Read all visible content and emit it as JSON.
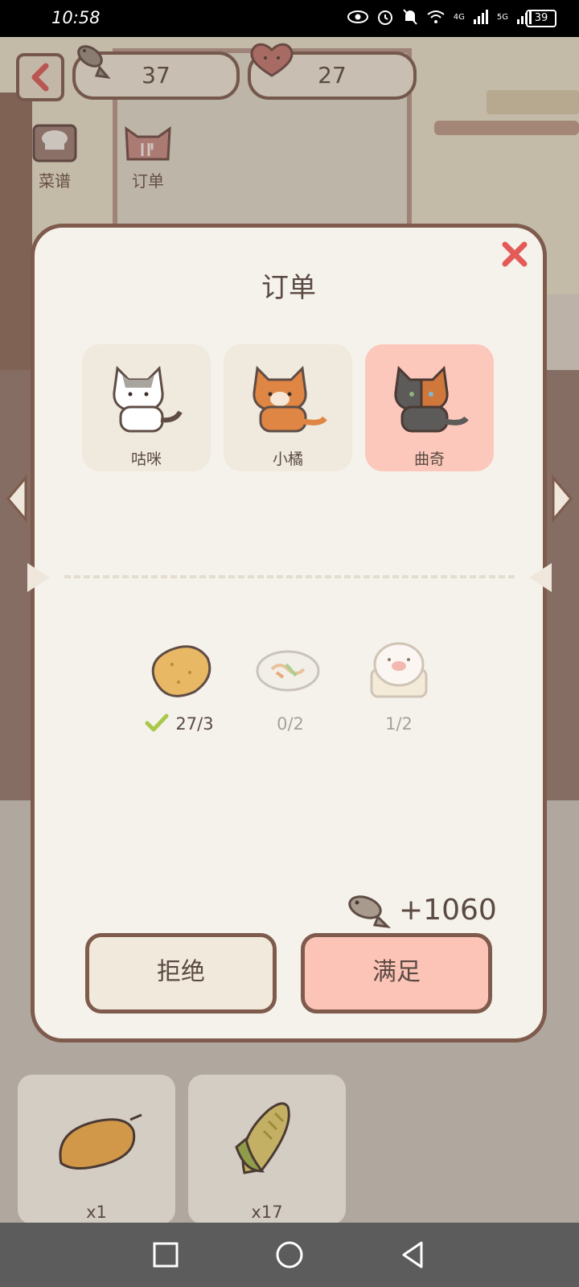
{
  "status_bar": {
    "time": "10:58",
    "net1": "4G",
    "net2": "5G",
    "battery": "39"
  },
  "hud": {
    "fish_count": "37",
    "heart_count": "27",
    "recipe_label": "菜谱",
    "order_label": "订单"
  },
  "modal": {
    "title": "订单",
    "cats": [
      {
        "name": "咕咪",
        "selected": false
      },
      {
        "name": "小橘",
        "selected": false
      },
      {
        "name": "曲奇",
        "selected": true
      }
    ],
    "dishes": [
      {
        "icon": "potato-icon",
        "progress": "27/3",
        "done": true
      },
      {
        "icon": "noodles-icon",
        "progress": "0/2",
        "done": false
      },
      {
        "icon": "pig-bun-icon",
        "progress": "1/2",
        "done": false
      }
    ],
    "reward": "+1060",
    "reject_label": "拒绝",
    "accept_label": "满足"
  },
  "inventory": [
    {
      "icon": "mango-icon",
      "count": "x1"
    },
    {
      "icon": "corn-icon",
      "count": "x17"
    }
  ],
  "colors": {
    "accent_pink": "#fcc4b7",
    "border_brown": "#7e5b4c",
    "close_red": "#e45a56",
    "check_green": "#a9c84a"
  }
}
